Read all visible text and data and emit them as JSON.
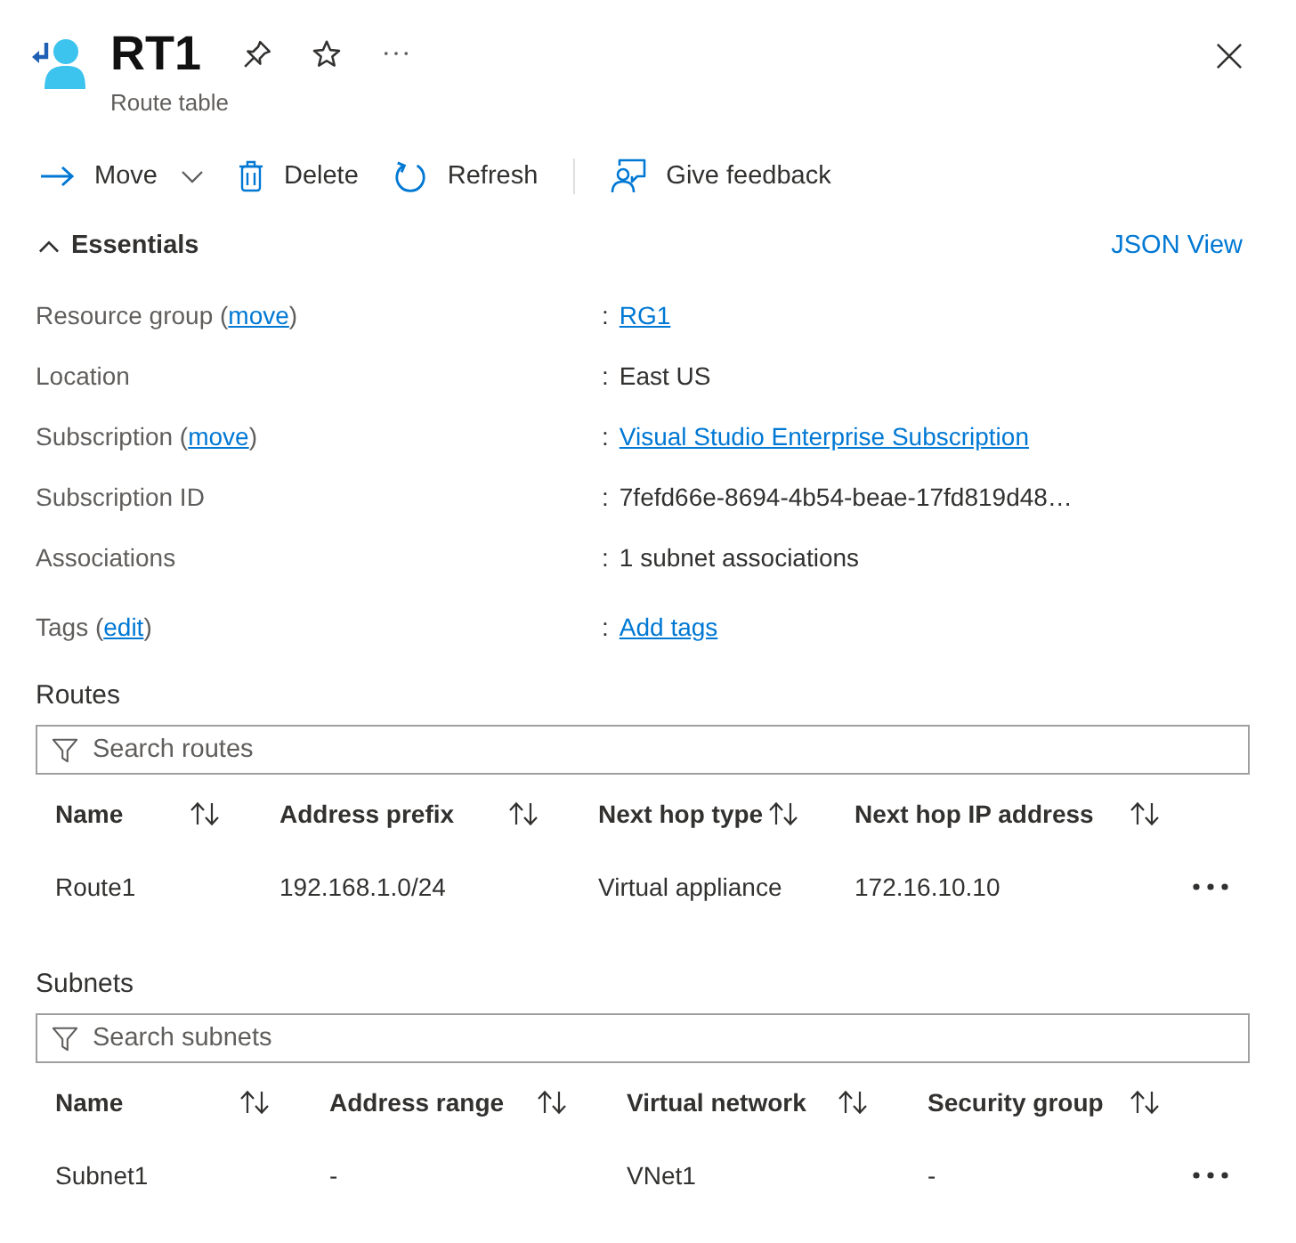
{
  "header": {
    "title": "RT1",
    "subtitle": "Route table"
  },
  "toolbar": {
    "move": {
      "label": "Move"
    },
    "delete": {
      "label": "Delete"
    },
    "refresh": {
      "label": "Refresh"
    },
    "feedback": {
      "label": "Give feedback"
    }
  },
  "essentials": {
    "label": "Essentials",
    "expanded": true,
    "json_view": "JSON View",
    "properties": [
      {
        "label": "Resource group (",
        "label_link": "move",
        "label_end": ")",
        "separator": ":",
        "value": "RG1",
        "value_link": true
      },
      {
        "label": "Location",
        "separator": ":",
        "value": "East US",
        "value_link": false
      },
      {
        "label": "Subscription (",
        "label_link": "move",
        "label_end": ")",
        "separator": ":",
        "value": "Visual Studio Enterprise Subscription",
        "value_link": true
      },
      {
        "label": "Subscription ID",
        "separator": ":",
        "value": "7fefd66e-8694-4b54-beae-17fd819d48…",
        "value_link": false
      },
      {
        "label": "Associations",
        "separator": ":",
        "value": "1 subnet associations",
        "value_link": false
      },
      {
        "label": "Tags (",
        "label_link": "edit",
        "label_end": ")",
        "separator": ":",
        "value": "Add tags",
        "value_link": true
      }
    ]
  },
  "routes": {
    "title": "Routes",
    "search": {
      "placeholder": "Search routes"
    },
    "columns": [
      "Name",
      "Address prefix",
      "Next hop type",
      "Next hop IP address"
    ],
    "rows": [
      {
        "cells": [
          "Route1",
          "192.168.1.0/24",
          "Virtual appliance",
          "172.16.10.10"
        ]
      }
    ]
  },
  "subnets": {
    "title": "Subnets",
    "search": {
      "placeholder": "Search subnets"
    },
    "columns": [
      "Name",
      "Address range",
      "Virtual network",
      "Security group"
    ],
    "rows": [
      {
        "cells": [
          "Subnet1",
          "-",
          "VNet1",
          "-"
        ]
      }
    ]
  }
}
